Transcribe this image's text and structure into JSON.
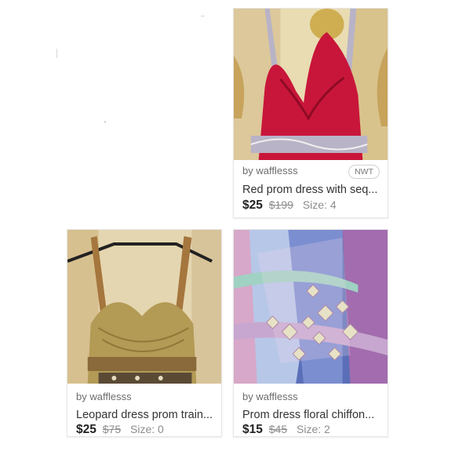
{
  "listings": [
    {
      "seller": "by wafflesss",
      "badge": "NWT",
      "title": "Red prom dress with seq...",
      "price": "$25",
      "original_price": "$199",
      "size": "Size: 4",
      "photo_colors": {
        "background": "#e9dcb2",
        "dress": "#c8163a",
        "accent": "#b9b3c7"
      }
    },
    {
      "seller": "by wafflesss",
      "title": "Leopard dress prom train...",
      "price": "$25",
      "original_price": "$75",
      "size": "Size: 0",
      "photo_colors": {
        "background": "#e4d6b0",
        "dress": "#b39a55",
        "accent": "#8a6a3a"
      }
    },
    {
      "seller": "by wafflesss",
      "title": "Prom dress floral chiffon...",
      "price": "$15",
      "original_price": "$45",
      "size": "Size: 2",
      "photo_colors": {
        "background": "#5a6fb7",
        "dress": "#c7a7cf",
        "accent": "#e7e2c6"
      }
    }
  ]
}
